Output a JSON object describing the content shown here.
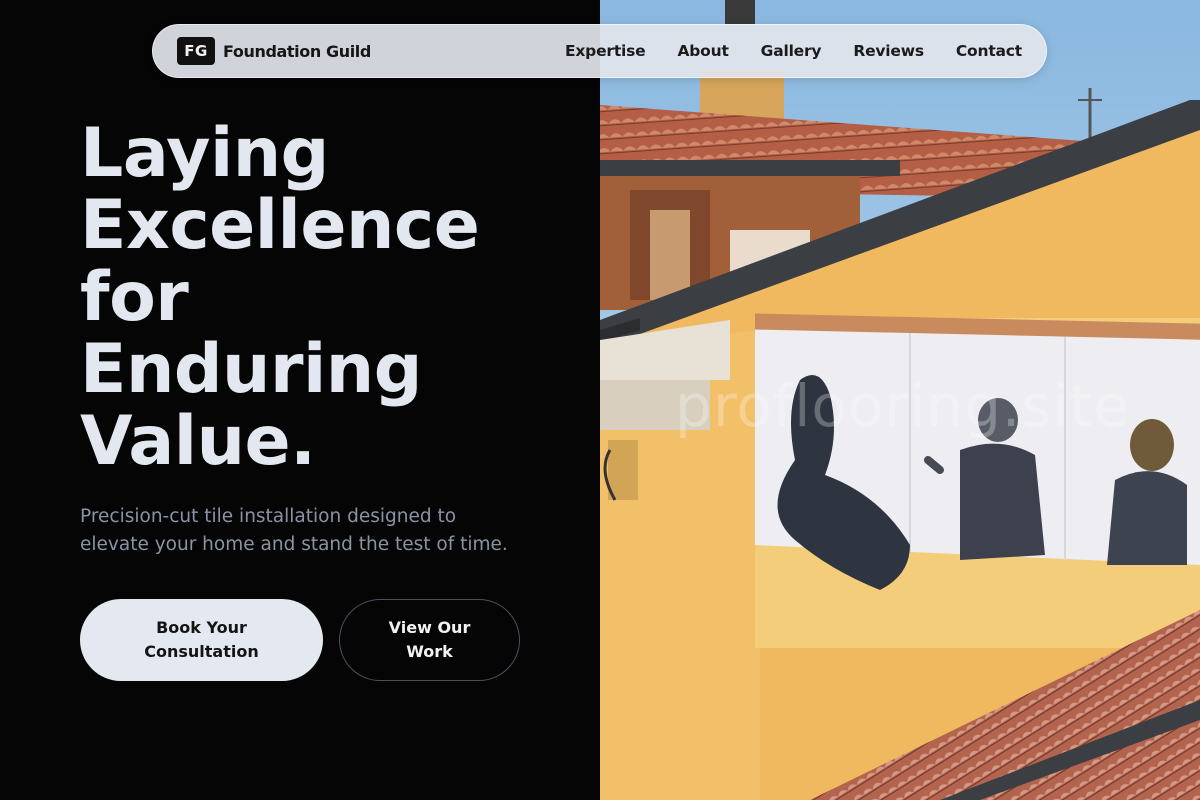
{
  "brand": {
    "logo_text": "FG",
    "name": "Foundation Guild"
  },
  "nav": {
    "links": [
      "Expertise",
      "About",
      "Gallery",
      "Reviews",
      "Contact"
    ]
  },
  "hero": {
    "headline_lines": [
      "Laying",
      "Excellence",
      "for",
      "Enduring",
      "Value."
    ],
    "subtext_lines": [
      "Precision-cut tile installation designed to",
      "elevate your home and stand the test of time."
    ],
    "primary_button_lines": [
      "Book Your",
      "Consultation"
    ],
    "secondary_button_lines": [
      "View Our",
      "Work"
    ]
  },
  "image": {
    "watermark": "proflooring.site",
    "colors": {
      "sky": "#9cc3e6",
      "wall": "#f1b95f",
      "roof": "#b9684f",
      "trim": "#3b3e42"
    }
  },
  "colors": {
    "background": "#050505",
    "headline": "#e3e7ef",
    "subtext": "#8a94a6",
    "nav_bg": "#e2e5eb",
    "button_primary_bg": "#e3e8f1"
  }
}
